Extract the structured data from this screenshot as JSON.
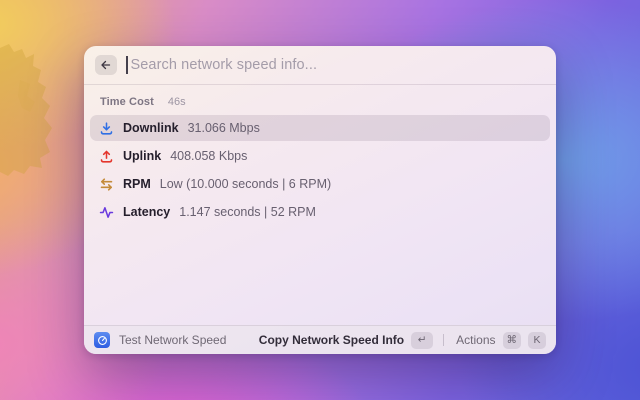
{
  "window": {
    "search": {
      "placeholder": "Search network speed info..."
    },
    "section": {
      "title": "Time Cost",
      "accessory": "46s"
    },
    "rows": [
      {
        "title": "Downlink",
        "value": "31.066 Mbps",
        "color": "#2f6fe4",
        "selected": true
      },
      {
        "title": "Uplink",
        "value": "408.058 Kbps",
        "color": "#e4352c",
        "selected": false
      },
      {
        "title": "RPM",
        "value": "Low (10.000 seconds | 6 RPM)",
        "color": "#c48b3a",
        "selected": false
      },
      {
        "title": "Latency",
        "value": "1.147 seconds | 52 RPM",
        "color": "#6a3ade",
        "selected": false
      }
    ],
    "footer": {
      "app_name": "Test Network Speed",
      "primary_action": "Copy Network Speed Info",
      "primary_key": "↵",
      "actions_label": "Actions",
      "actions_key_1": "⌘",
      "actions_key_2": "K"
    }
  }
}
